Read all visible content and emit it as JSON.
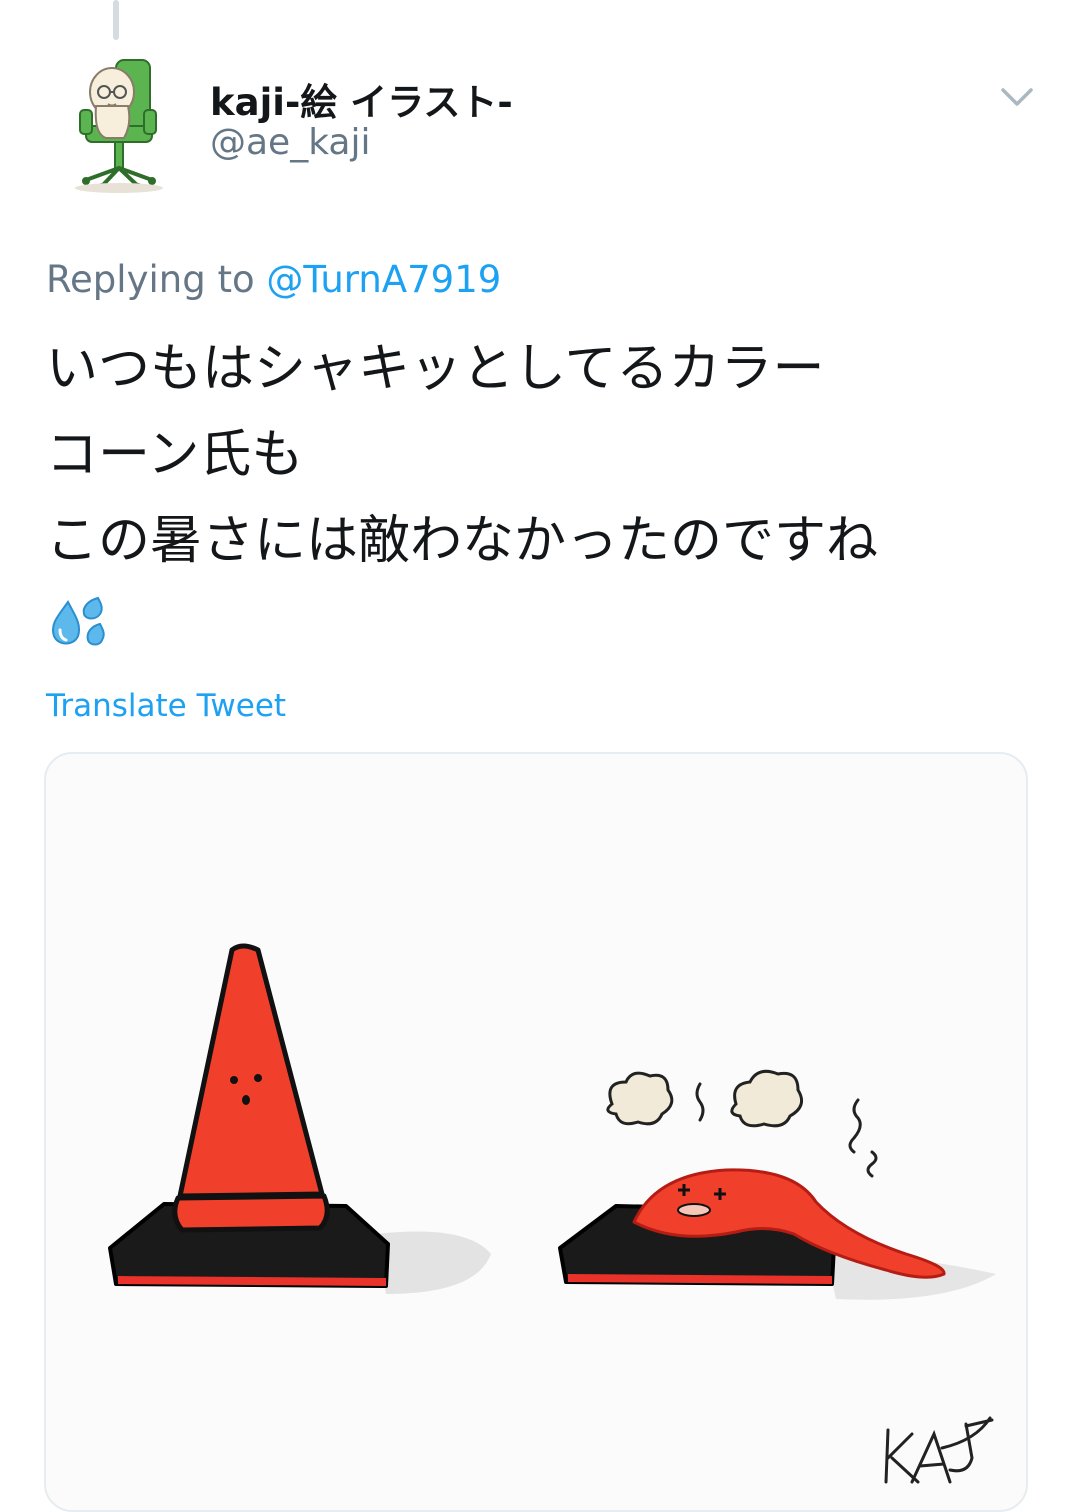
{
  "tweet": {
    "display_name": "kaji-絵 イラスト-",
    "handle": "@ae_kaji",
    "replying_prefix": "Replying to ",
    "replying_to": "@TurnA7919",
    "text": "いつもはシャキッとしてるカラー\nコーン氏も\nこの暑さには敵わなかったのですね",
    "emoji": "sweat-droplets-emoji",
    "translate_label": "Translate Tweet",
    "caret_icon": "chevron-down-icon",
    "image_alt": "illustration of a standing traffic cone and a melted traffic cone",
    "signature": "KAJI"
  },
  "colors": {
    "link": "#1da1f2",
    "secondary_text": "#657786",
    "primary_text": "#14171a",
    "cone_red": "#f0402c",
    "avatar_chair": "#5bb450"
  }
}
